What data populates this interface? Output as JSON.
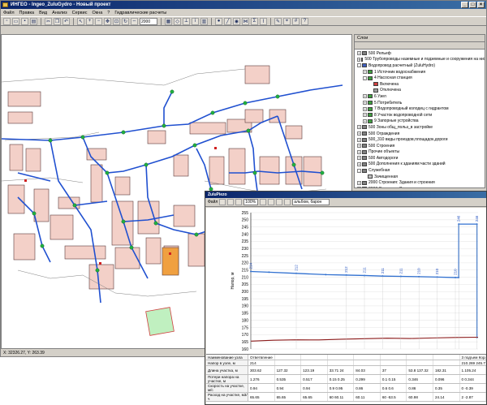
{
  "window": {
    "title": "ИНГЕО - Ingeo_ZuluGydro - Новый проект"
  },
  "menu": [
    "Файл",
    "Правка",
    "Вид",
    "Анализ",
    "Сервис",
    "Окна",
    "?",
    "Гидравлические расчеты"
  ],
  "toolbar": {
    "zoom_value": "2000"
  },
  "status": {
    "coords": "X: 32326.27, Y: 263.39"
  },
  "layers": {
    "title": "Слои",
    "items": [
      {
        "label": "500 Рельеф",
        "level": 0,
        "exp": "+",
        "color": "#808080"
      },
      {
        "label": "500 Трубопроводы наземные и подземные и сооружения на них",
        "level": 0,
        "exp": "+",
        "color": "#808080"
      },
      {
        "label": "Водопровод расчетный (ZuluHydro)",
        "level": 0,
        "exp": "-",
        "color": "#4060c0"
      },
      {
        "label": "1 Источник водоснабжения",
        "level": 1,
        "exp": "+",
        "color": "#40a040"
      },
      {
        "label": "4 Насосная станция",
        "level": 1,
        "exp": "-",
        "color": "#40a040"
      },
      {
        "label": "Включена",
        "level": 2,
        "exp": "",
        "color": "#d04040"
      },
      {
        "label": "Отключена",
        "level": 2,
        "exp": "",
        "color": "#a0a0a0"
      },
      {
        "label": "6 Узел",
        "level": 1,
        "exp": "+",
        "color": "#40a040"
      },
      {
        "label": "5 Потребитель",
        "level": 1,
        "exp": "+",
        "color": "#40a040"
      },
      {
        "label": "7 Водопроводный колодец с гидрантом",
        "level": 1,
        "exp": "+",
        "color": "#40a040"
      },
      {
        "label": "8 Участок водопроводной сети",
        "level": 1,
        "exp": "+",
        "color": "#40a040"
      },
      {
        "label": "9 Запорные устройства",
        "level": 1,
        "exp": "+",
        "color": "#40a040"
      },
      {
        "label": "500 Зоны общ_польз_в застройке",
        "level": 0,
        "exp": "+",
        "color": "#808080"
      },
      {
        "label": "500 Ограждения",
        "level": 0,
        "exp": "+",
        "color": "#808080"
      },
      {
        "label": "500_310 виды проездов,площадок,дороги",
        "level": 0,
        "exp": "+",
        "color": "#808080"
      },
      {
        "label": "500 Строения",
        "level": 0,
        "exp": "+",
        "color": "#808080"
      },
      {
        "label": "Прочие объекты",
        "level": 0,
        "exp": "+",
        "color": "#808080"
      },
      {
        "label": "500 Автодороги",
        "level": 0,
        "exp": "+",
        "color": "#808080"
      },
      {
        "label": "500 Дополнения к зданиям:части зданий",
        "level": 0,
        "exp": "+",
        "color": "#808080"
      },
      {
        "label": "Служебная",
        "level": 0,
        "exp": "-",
        "color": "#808080"
      },
      {
        "label": "Зачищенная",
        "level": 1,
        "exp": "",
        "color": "#c0c0c0"
      },
      {
        "label": "2000 Строения: Здания и строения",
        "level": 0,
        "exp": "+",
        "color": "#808080"
      },
      {
        "label": "2000 Строения: Сооружения, памятники",
        "level": 0,
        "exp": "+",
        "color": "#808080"
      },
      {
        "label": "Водопровод",
        "level": 0,
        "exp": "+",
        "color": "#4060c0"
      }
    ]
  },
  "profile": {
    "title": "ZuluPiezo",
    "file_menu": "Файл",
    "zoom": "100%",
    "units": "альбом, барон"
  },
  "chart_data": {
    "type": "line",
    "ylabel": "Напор, м",
    "ylim": [
      160,
      255
    ],
    "yticks": [
      160,
      165,
      170,
      175,
      180,
      185,
      190,
      195,
      200,
      205,
      210,
      215,
      220,
      225,
      230,
      235,
      240,
      245,
      250,
      255
    ],
    "series": [
      {
        "role": "pressure",
        "color": "#3070d0",
        "x": [
          0.0,
          0.08,
          0.2,
          0.33,
          0.42,
          0.5,
          0.58,
          0.66,
          0.74,
          0.82,
          0.9,
          0.915,
          0.915,
          0.995,
          0.995
        ],
        "y": [
          214,
          213.5,
          212.7,
          211.8,
          211.5,
          211.2,
          210.8,
          210.6,
          210.4,
          210.1,
          209.8,
          209.8,
          247,
          247,
          168
        ]
      },
      {
        "role": "ground",
        "color": "#8b1a1a",
        "x": [
          0.0,
          0.1,
          0.2,
          0.3,
          0.4,
          0.5,
          0.6,
          0.7,
          0.8,
          0.9,
          1.0
        ],
        "y": [
          165.5,
          166.1,
          166.4,
          166.3,
          166.8,
          167.2,
          167.5,
          167.3,
          167.7,
          168.0,
          168.2
        ]
      }
    ],
    "point_labels": [
      {
        "x": 0.0,
        "y": 214,
        "label": "214"
      },
      {
        "x": 0.2,
        "y": 212.7,
        "label": "212"
      },
      {
        "x": 0.42,
        "y": 211.5,
        "label": "212"
      },
      {
        "x": 0.5,
        "y": 211.2,
        "label": "211"
      },
      {
        "x": 0.58,
        "y": 210.8,
        "label": "211"
      },
      {
        "x": 0.66,
        "y": 210.6,
        "label": "211"
      },
      {
        "x": 0.74,
        "y": 210.4,
        "label": "210"
      },
      {
        "x": 0.82,
        "y": 210.1,
        "label": "210"
      },
      {
        "x": 0.9,
        "y": 209.8,
        "label": "210"
      },
      {
        "x": 0.915,
        "y": 247,
        "label": "246"
      },
      {
        "x": 0.995,
        "y": 247,
        "label": "246"
      }
    ]
  },
  "table": {
    "rows": [
      {
        "header": "Наименование узла",
        "cells": [
          "Ответвление",
          "",
          "",
          "",
          "",
          "",
          "",
          "",
          "3 подъем Корабельная 1"
        ]
      },
      {
        "header": "Напор в узле, м",
        "cells": [
          "214",
          "",
          "",
          "",
          "",
          "",
          "",
          "",
          "210.269   245.711"
        ]
      },
      {
        "header": "Длина участка, м",
        "cells": [
          "303.62",
          "127.32",
          "123.19",
          "33.71 24",
          "84.03",
          "37",
          "53.8 137.32",
          "182.31",
          "1.105.24"
        ]
      },
      {
        "header": "Потери напора на участке, м",
        "cells": [
          "1.276",
          "0.535",
          "0.517",
          "0.15 0.25",
          "0.299",
          "0.1 0.15",
          "0.346",
          "0.096",
          "0 0.344"
        ]
      },
      {
        "header": "Скорость на участке, м/с",
        "cells": [
          "0.94",
          "0.94",
          "0.94",
          "0.9 0.95",
          "0.86",
          "0.6 0.6",
          "0.86",
          "0.35",
          "0 -0.39"
        ]
      },
      {
        "header": "Расход на участке, м3/ч",
        "cells": [
          "65.65",
          "65.65",
          "65.65",
          "60 60.11",
          "60.11",
          "60 -53.5",
          "60.98",
          "24.14",
          "2 -2.87"
        ]
      }
    ]
  }
}
